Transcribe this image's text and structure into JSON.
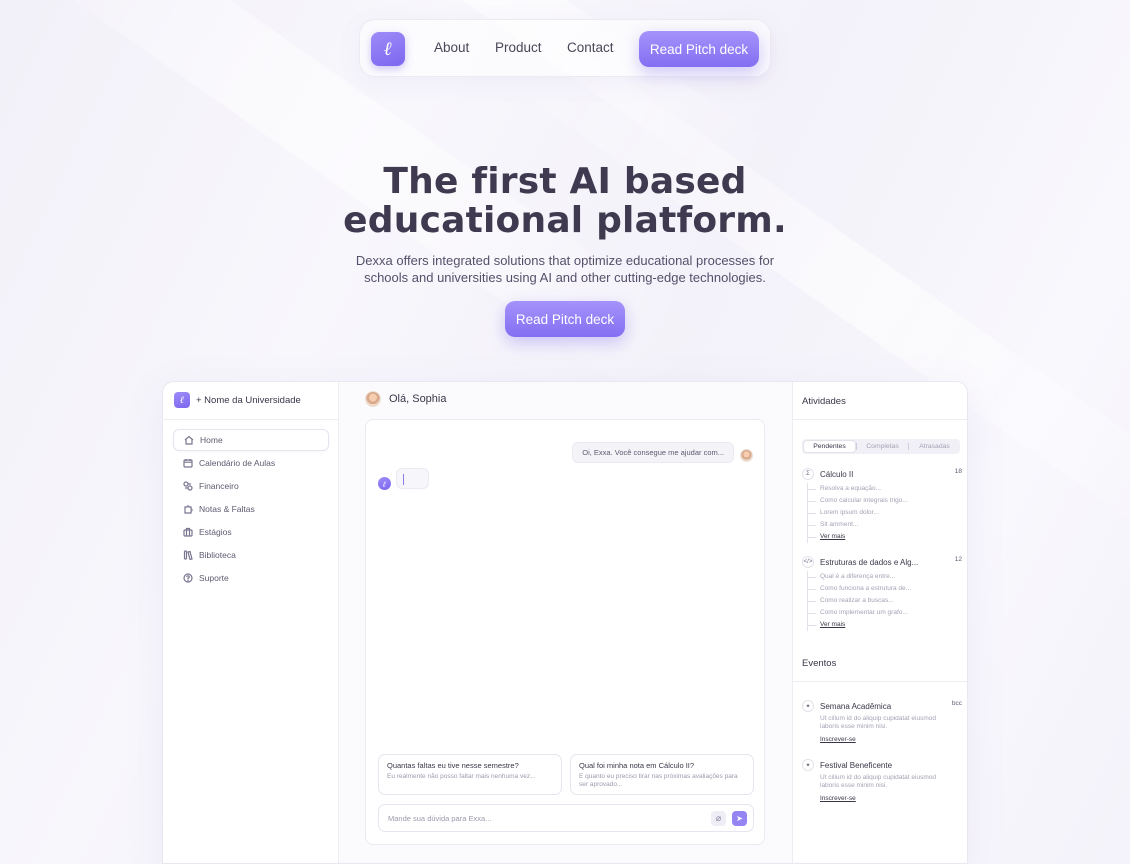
{
  "nav": {
    "logo_glyph": "ℓ",
    "links": [
      "About",
      "Product",
      "Contact"
    ],
    "cta": "Read Pitch deck"
  },
  "hero": {
    "title_line1": "The first AI based",
    "title_line2": "educational platform.",
    "subtitle_line1": "Dexxa offers integrated solutions that optimize educational processes for",
    "subtitle_line2": "schools and universities using AI and other cutting-edge technologies.",
    "cta": "Read Pitch deck"
  },
  "app": {
    "sidebar": {
      "university": "+ Nome da Universidade",
      "items": [
        {
          "label": "Home",
          "icon": "home-icon",
          "active": true
        },
        {
          "label": "Calendário de Aulas",
          "icon": "calendar-icon"
        },
        {
          "label": "Financeiro",
          "icon": "finance-icon"
        },
        {
          "label": "Notas & Faltas",
          "icon": "puzzle-icon"
        },
        {
          "label": "Estágios",
          "icon": "briefcase-icon"
        },
        {
          "label": "Biblioteca",
          "icon": "books-icon"
        },
        {
          "label": "Suporte",
          "icon": "help-icon"
        }
      ]
    },
    "main": {
      "greeting": "Olá, Sophia",
      "user_message": "Oi, Exxa. Você consegue me ajudar com...",
      "suggestions": [
        {
          "question": "Quantas faltas eu tive nesse semestre?",
          "detail": "Eu realmente não posso faltar mais nenhuma vez..."
        },
        {
          "question": "Qual foi minha nota em Cálculo II?",
          "detail": "E quanto eu preciso tirar nas próximas avaliações para ser aprovado..."
        }
      ],
      "input_placeholder": "Mande sua dúvida para Exxa..."
    },
    "right": {
      "activities_title": "Atividades",
      "tabs": [
        "Pendentes",
        "Completas",
        "Atrasadas"
      ],
      "courses": [
        {
          "icon": "Σ",
          "name": "Cálculo II",
          "count": "18",
          "items": [
            "Resolva a equação...",
            "Como calcular integrais trigo...",
            "Lorem ipsum dolor...",
            "Sit amment..."
          ],
          "more": "Ver mais"
        },
        {
          "icon": "</>",
          "name": "Estruturas de dados e Alg...",
          "count": "12",
          "items": [
            "Qual é a diferença entre...",
            "Como funciona a estrutura de...",
            "Como realizar a buscas...",
            "Como implementar um grafo..."
          ],
          "more": "Ver mais"
        }
      ],
      "events_title": "Eventos",
      "events": [
        {
          "name": "Semana Acadêmica",
          "tag": "bcc",
          "desc_line1": "Ut cillum id do aliquip cupidatat eiusmod",
          "desc_line2": "laboris esse minim nisi.",
          "action": "Inscrever-se"
        },
        {
          "name": "Festival Beneficente",
          "tag": "",
          "desc_line1": "Ut cillum id do aliquip cupidatat eiusmod",
          "desc_line2": "laboris esse minim nisi.",
          "action": "Inscrever-se"
        }
      ]
    }
  },
  "colors": {
    "accent": "#8b78f4",
    "text": "#3f3a4f"
  }
}
